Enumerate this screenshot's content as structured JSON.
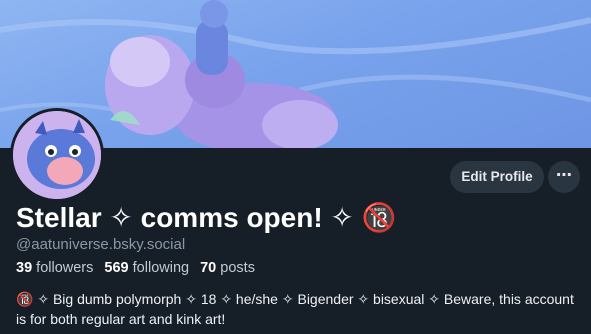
{
  "banner": {
    "image": "pastel purple creatures on blue sky banner"
  },
  "avatar": {
    "image": "blue dragon avatar"
  },
  "actions": {
    "edit_profile_label": "Edit Profile",
    "more_label": "⋯"
  },
  "profile": {
    "display_name": "Stellar ✧ comms open! ✧ 🔞",
    "handle": "@aatuniverse.bsky.social",
    "followers_count": "39",
    "followers_label": "followers",
    "following_count": "569",
    "following_label": "following",
    "posts_count": "70",
    "posts_label": "posts",
    "bio": "🔞 ✧ Big dumb polymorph ✧ 18 ✧ he/she ✧ Bigender ✧ bisexual ✧ Beware, this account is for both regular art and kink art!"
  },
  "colors": {
    "background": "#161e27",
    "button": "#2a3542",
    "muted": "#8a98a9"
  }
}
